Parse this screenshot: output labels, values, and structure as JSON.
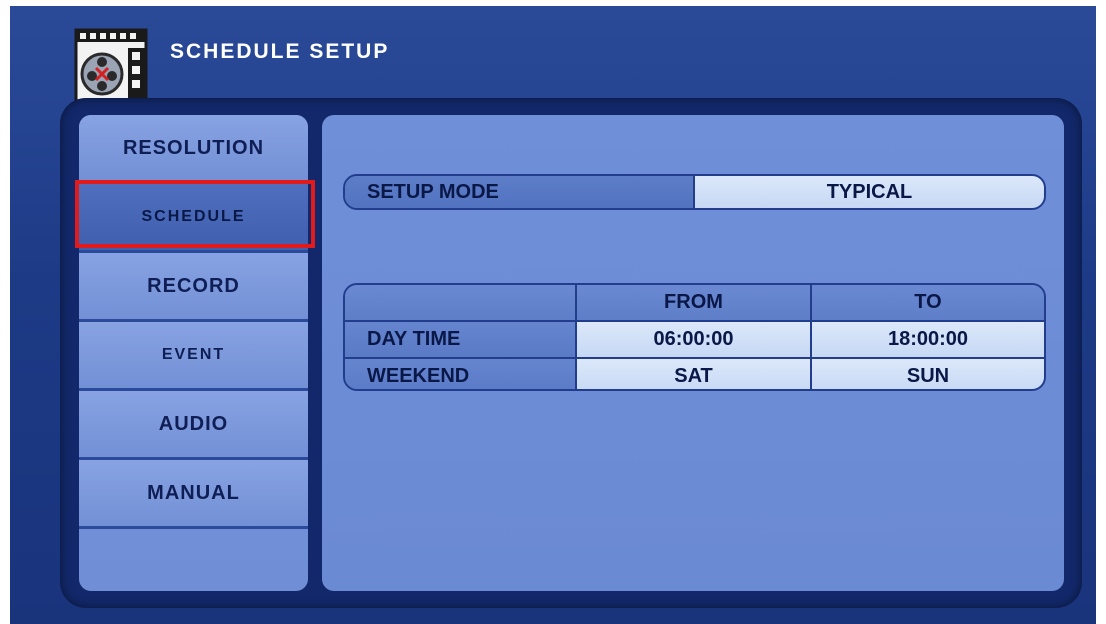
{
  "header": {
    "title": "SCHEDULE SETUP",
    "icon": "film-reel-icon"
  },
  "sidebar": {
    "items": [
      {
        "label": "RESOLUTION"
      },
      {
        "label": "SCHEDULE"
      },
      {
        "label": "RECORD"
      },
      {
        "label": "EVENT"
      },
      {
        "label": "AUDIO"
      },
      {
        "label": "MANUAL"
      }
    ],
    "selected": "SCHEDULE"
  },
  "setup_mode": {
    "label": "SETUP MODE",
    "value": "TYPICAL"
  },
  "schedule_table": {
    "headers": [
      "",
      "FROM",
      "TO"
    ],
    "rows": [
      {
        "label": "DAY TIME",
        "from": "06:00:00",
        "to": "18:00:00"
      },
      {
        "label": "WEEKEND",
        "from": "SAT",
        "to": "SUN"
      }
    ]
  },
  "colors": {
    "highlight": "#e11b1b",
    "background": "#1d3a86"
  }
}
